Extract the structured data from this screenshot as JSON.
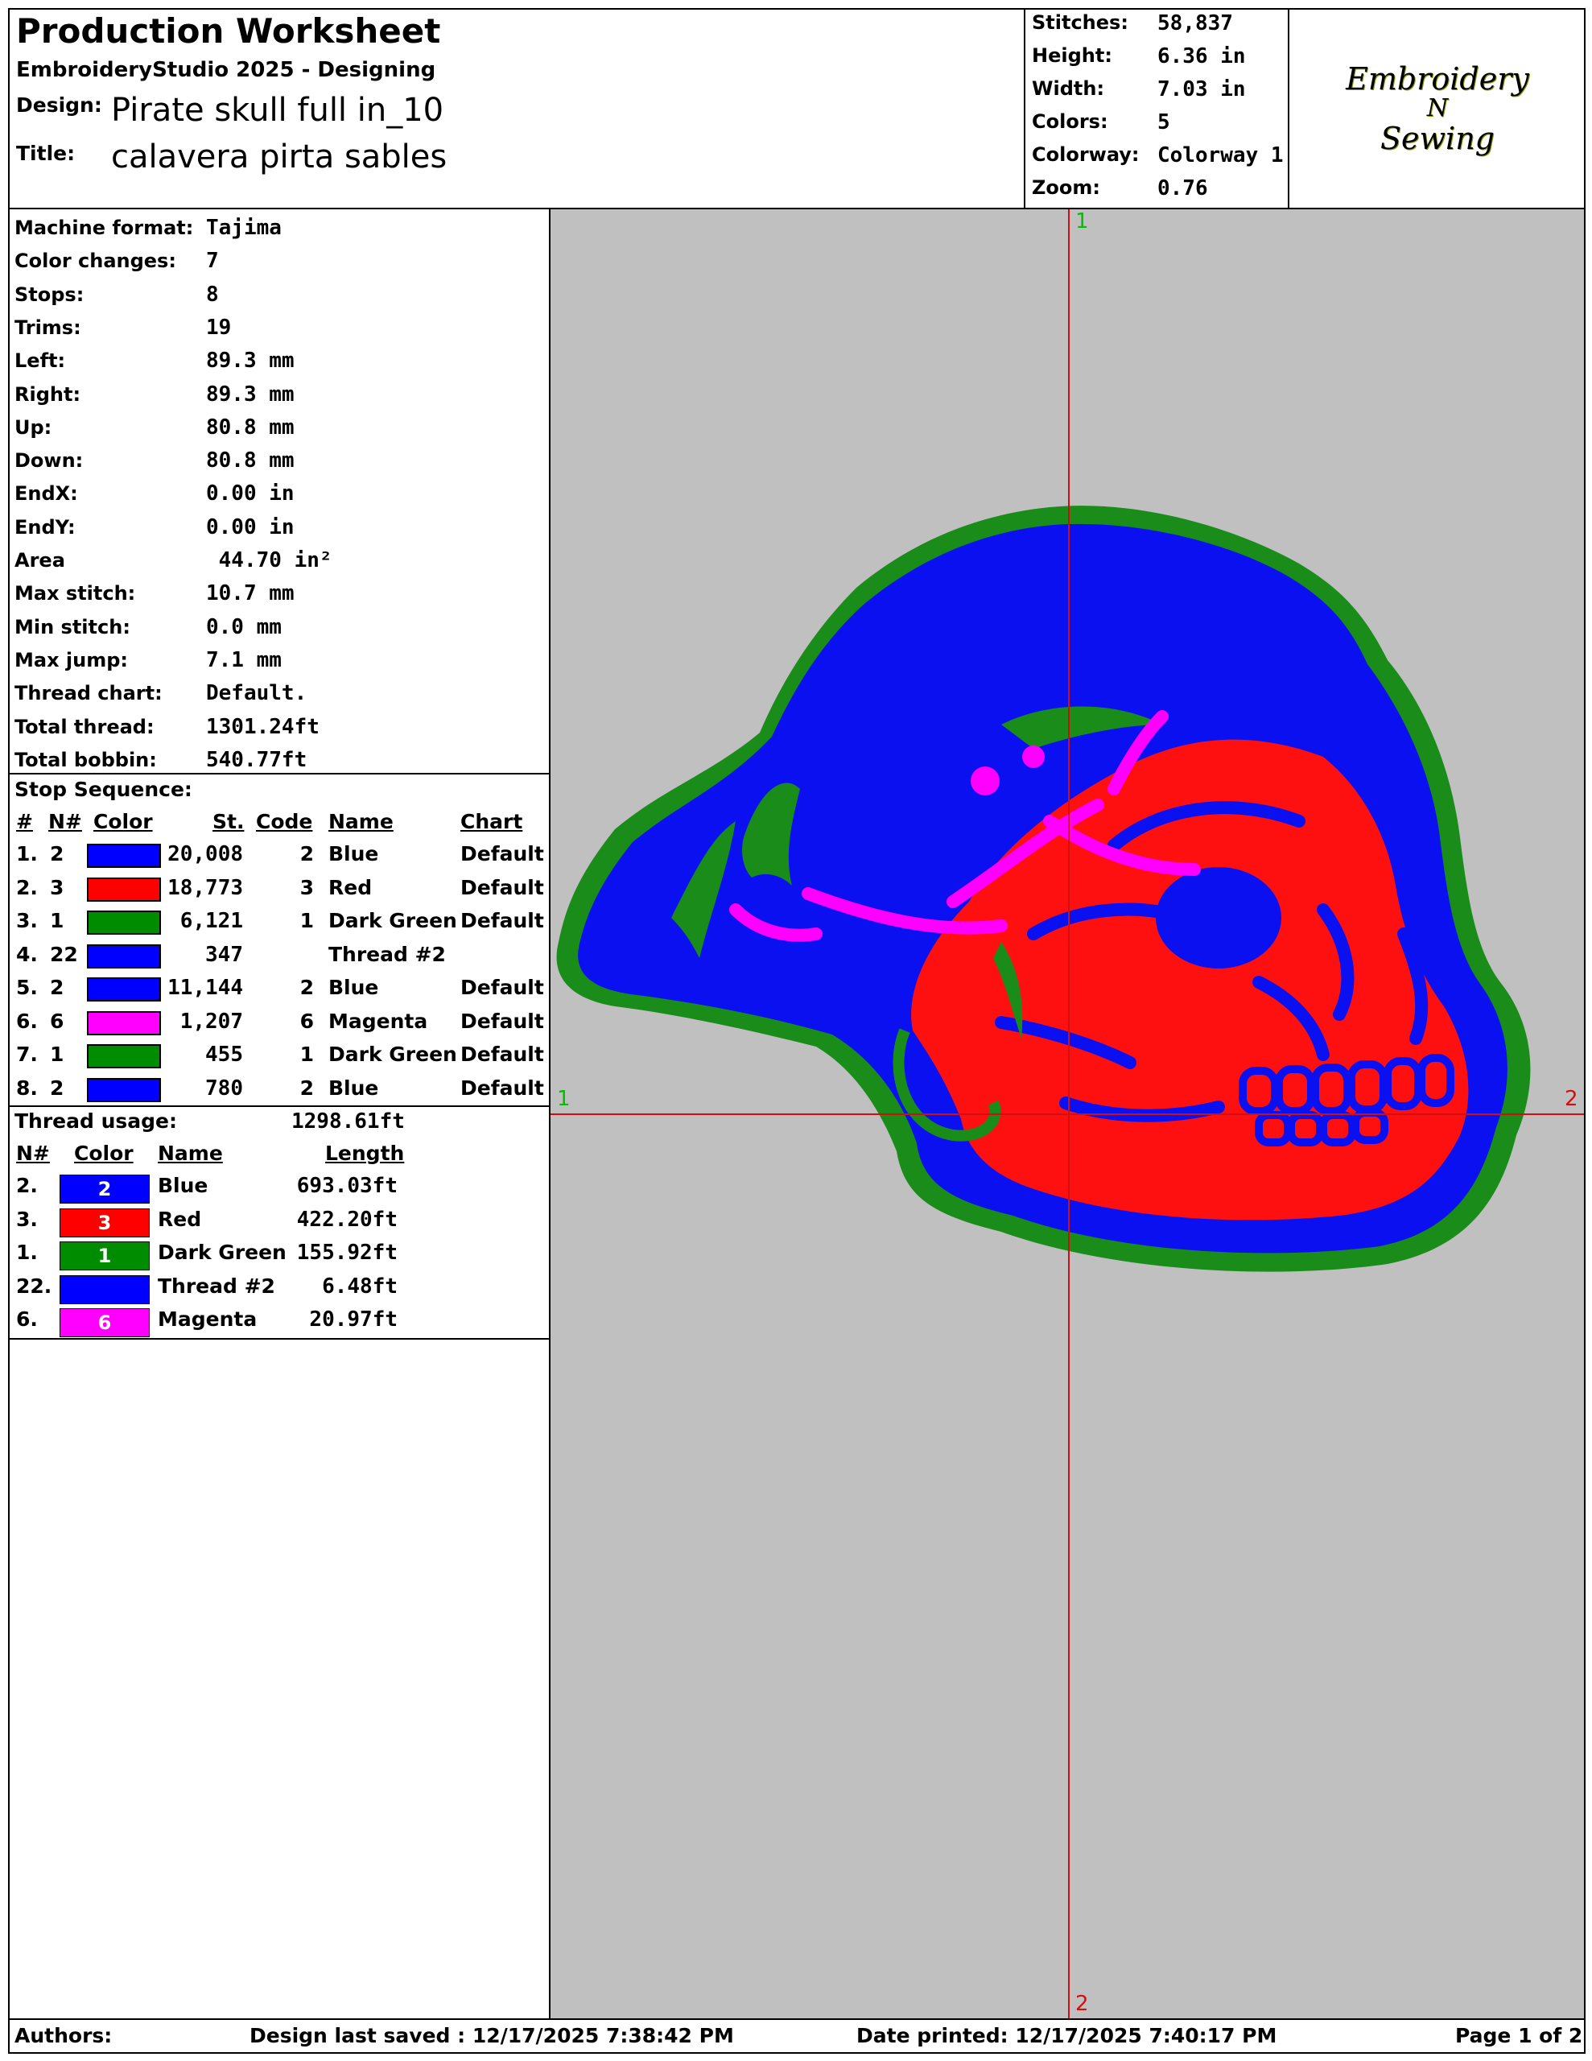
{
  "header": {
    "title": "Production Worksheet",
    "software": "EmbroideryStudio 2025 - Designing",
    "design_label": "Design:",
    "design_value": "Pirate skull full in_10",
    "title_label": "Title:",
    "title_value": "calavera pirta sables"
  },
  "summary": [
    {
      "label": "Stitches:",
      "value": "58,837"
    },
    {
      "label": "Height:",
      "value": "6.36 in"
    },
    {
      "label": "Width:",
      "value": "7.03 in"
    },
    {
      "label": "Colors:",
      "value": "5"
    },
    {
      "label": "Colorway:",
      "value": "Colorway 1"
    },
    {
      "label": "Zoom:",
      "value": "0.76"
    }
  ],
  "logo": {
    "line1": "Embroidery",
    "line2": "N",
    "line3": "Sewing"
  },
  "details": [
    {
      "label": "Machine format:",
      "value": "Tajima"
    },
    {
      "label": "Color changes:",
      "value": "7"
    },
    {
      "label": "Stops:",
      "value": "8"
    },
    {
      "label": "Trims:",
      "value": "19"
    },
    {
      "label": "Left:",
      "value": "89.3 mm"
    },
    {
      "label": "Right:",
      "value": "89.3 mm"
    },
    {
      "label": "Up:",
      "value": "80.8 mm"
    },
    {
      "label": "Down:",
      "value": "80.8 mm"
    },
    {
      "label": "EndX:",
      "value": "0.00 in"
    },
    {
      "label": "EndY:",
      "value": "0.00 in"
    },
    {
      "label": "Area",
      "value": " 44.70 in²"
    },
    {
      "label": "Max stitch:",
      "value": "10.7 mm"
    },
    {
      "label": "Min stitch:",
      "value": "0.0 mm"
    },
    {
      "label": "Max jump:",
      "value": "7.1 mm"
    },
    {
      "label": "Thread chart:",
      "value": "Default."
    },
    {
      "label": "Total thread:",
      "value": "1301.24ft"
    },
    {
      "label": "Total bobbin:",
      "value": "540.77ft"
    }
  ],
  "stop_sequence": {
    "title": "Stop Sequence:",
    "headers": {
      "num": "#",
      "n": "N#",
      "color": "Color",
      "st": "St.",
      "code": "Code",
      "name": "Name",
      "chart": "Chart"
    },
    "rows": [
      {
        "num": "1.",
        "n": "2",
        "color": "#0000ff",
        "st": "20,008",
        "code": "2",
        "name": "Blue",
        "chart": "Default"
      },
      {
        "num": "2.",
        "n": "3",
        "color": "#ff0000",
        "st": "18,773",
        "code": "3",
        "name": "Red",
        "chart": "Default"
      },
      {
        "num": "3.",
        "n": "1",
        "color": "#008c00",
        "st": "6,121",
        "code": "1",
        "name": "Dark Green",
        "chart": "Default"
      },
      {
        "num": "4.",
        "n": "22",
        "color": "#0000ff",
        "st": "347",
        "code": "",
        "name": "Thread #2",
        "chart": ""
      },
      {
        "num": "5.",
        "n": "2",
        "color": "#0000ff",
        "st": "11,144",
        "code": "2",
        "name": "Blue",
        "chart": "Default"
      },
      {
        "num": "6.",
        "n": "6",
        "color": "#ff00ff",
        "st": "1,207",
        "code": "6",
        "name": "Magenta",
        "chart": "Default"
      },
      {
        "num": "7.",
        "n": "1",
        "color": "#008c00",
        "st": "455",
        "code": "1",
        "name": "Dark Green",
        "chart": "Default"
      },
      {
        "num": "8.",
        "n": "2",
        "color": "#0000ff",
        "st": "780",
        "code": "2",
        "name": "Blue",
        "chart": "Default"
      }
    ]
  },
  "thread_usage": {
    "title": "Thread usage:",
    "total": "1298.61ft",
    "headers": {
      "n": "N#",
      "color": "Color",
      "name": "Name",
      "length": "Length"
    },
    "rows": [
      {
        "n": "2.",
        "color": "#0000ff",
        "code": "2",
        "name": "Blue",
        "length": "693.03ft"
      },
      {
        "n": "3.",
        "color": "#ff0000",
        "code": "3",
        "name": "Red",
        "length": "422.20ft"
      },
      {
        "n": "1.",
        "color": "#008c00",
        "code": "1",
        "name": "Dark Green",
        "length": "155.92ft"
      },
      {
        "n": "22.",
        "color": "#0000ff",
        "code": "",
        "name": "Thread #2",
        "length": "6.48ft"
      },
      {
        "n": "6.",
        "color": "#ff00ff",
        "code": "6",
        "name": "Magenta",
        "length": "20.97ft"
      }
    ]
  },
  "preview": {
    "background": "#c0c0c0",
    "axis_color": "#d01010",
    "marker_color": "#00c000",
    "markers": {
      "top": "1",
      "left": "1",
      "right": "2",
      "bottom": "2"
    }
  },
  "footer": {
    "authors": "Authors:",
    "saved": "Design last saved : 12/17/2025 7:38:42 PM",
    "printed": "Date printed: 12/17/2025 7:40:17 PM",
    "page": "Page 1 of 2"
  }
}
